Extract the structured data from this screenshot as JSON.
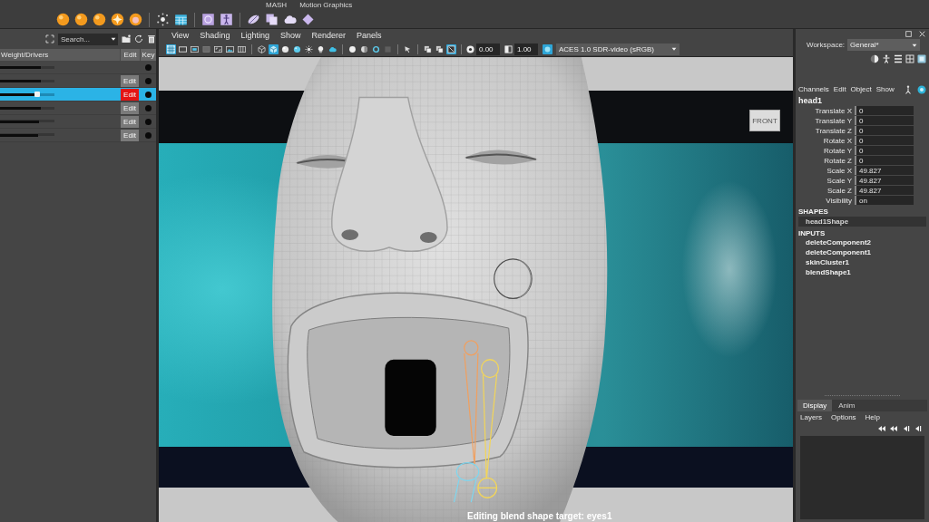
{
  "shelf": {
    "tabs": [
      {
        "label": "MASH",
        "selected": false
      },
      {
        "label": "Motion Graphics",
        "selected": false
      }
    ]
  },
  "shape_editor": {
    "search": {
      "placeholder": "Search..."
    },
    "columns": [
      "Weight/Drivers",
      "Edit",
      "Key"
    ],
    "rows": [
      {
        "kind": "node",
        "level": 0.75,
        "selected": false
      },
      {
        "kind": "target",
        "level": 0.75,
        "selected": false,
        "edit": "Edit",
        "editing": false
      },
      {
        "kind": "target",
        "level": 0.68,
        "selected": true,
        "edit": "Edit",
        "editing": true
      },
      {
        "kind": "target",
        "level": 0.75,
        "selected": false,
        "edit": "Edit",
        "editing": false
      },
      {
        "kind": "target",
        "level": 0.72,
        "selected": false,
        "edit": "Edit",
        "editing": false
      },
      {
        "kind": "target",
        "level": 0.7,
        "selected": false,
        "edit": "Edit",
        "editing": false
      }
    ]
  },
  "viewport": {
    "menu": [
      "View",
      "Shading",
      "Lighting",
      "Show",
      "Renderer",
      "Panels"
    ],
    "toolbar": [
      {
        "kind": "grid",
        "on": true
      },
      {
        "kind": "rectangle",
        "on": false
      },
      {
        "kind": "screen",
        "on": false
      },
      {
        "kind": "filled-square",
        "on": false
      },
      {
        "kind": "corners",
        "on": false
      },
      {
        "kind": "picture",
        "on": false
      },
      {
        "kind": "columns",
        "on": false
      },
      {
        "kind": "separator"
      },
      {
        "kind": "wire-cube",
        "on": false
      },
      {
        "kind": "cube",
        "on": true
      },
      {
        "kind": "sphere",
        "on": false
      },
      {
        "kind": "shiny-sphere",
        "on": false
      },
      {
        "kind": "burst",
        "on": false
      },
      {
        "kind": "bulb",
        "on": false
      },
      {
        "kind": "cloud",
        "on": false
      },
      {
        "kind": "separator"
      },
      {
        "kind": "ball",
        "on": false
      },
      {
        "kind": "half-circle",
        "on": false
      },
      {
        "kind": "ring",
        "on": false
      },
      {
        "kind": "square",
        "on": false
      },
      {
        "kind": "separator"
      },
      {
        "kind": "arrow",
        "on": false
      },
      {
        "kind": "separator"
      },
      {
        "kind": "stacked-squares",
        "on": false
      },
      {
        "kind": "stacked-squares",
        "on": false
      },
      {
        "kind": "crossed-square",
        "on": true
      }
    ],
    "exposure": "0.00",
    "gamma": "1.00",
    "color_management": {
      "on": true,
      "value": "ACES 1.0 SDR-video (sRGB)"
    },
    "view_cube": "FRONT",
    "status": "Editing blend shape target: eyes1"
  },
  "workspace": {
    "label": "Workspace:",
    "value": "General*"
  },
  "channel_box": {
    "menu": [
      "Channels",
      "Edit",
      "Object",
      "Show"
    ],
    "object": "head1",
    "attributes": [
      {
        "name": "Translate X",
        "value": "0"
      },
      {
        "name": "Translate Y",
        "value": "0"
      },
      {
        "name": "Translate Z",
        "value": "0"
      },
      {
        "name": "Rotate X",
        "value": "0"
      },
      {
        "name": "Rotate Y",
        "value": "0"
      },
      {
        "name": "Rotate Z",
        "value": "0"
      },
      {
        "name": "Scale X",
        "value": "49.827"
      },
      {
        "name": "Scale Y",
        "value": "49.827"
      },
      {
        "name": "Scale Z",
        "value": "49.827"
      },
      {
        "name": "Visibility",
        "value": "on"
      }
    ],
    "shapes_heading": "SHAPES",
    "shapes": [
      "head1Shape"
    ],
    "inputs_heading": "INPUTS",
    "inputs": [
      "deleteComponent2",
      "deleteComponent1",
      "skinCluster1",
      "blendShape1"
    ]
  },
  "layer_editor": {
    "tabs": [
      {
        "label": "Display",
        "selected": true
      },
      {
        "label": "Anim",
        "selected": false
      }
    ],
    "menu": [
      "Layers",
      "Options",
      "Help"
    ]
  }
}
